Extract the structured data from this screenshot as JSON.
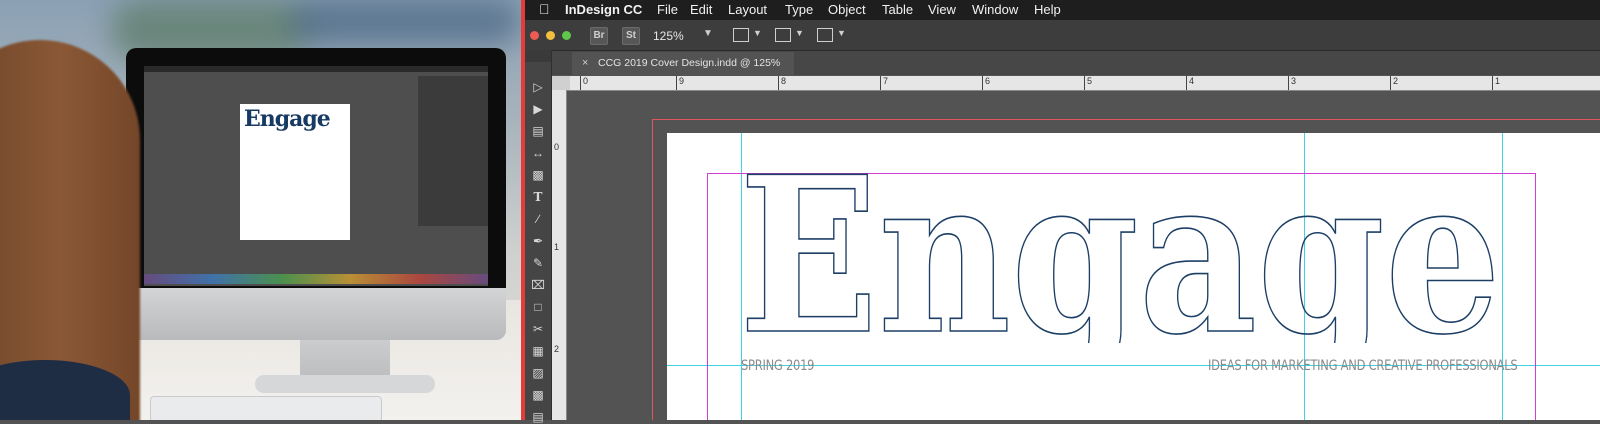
{
  "photo": {
    "mini_title": "Engage"
  },
  "menubar": {
    "app_name": "InDesign CC",
    "items": [
      "File",
      "Edit",
      "Layout",
      "Type",
      "Object",
      "Table",
      "View",
      "Window",
      "Help"
    ]
  },
  "controlbar": {
    "bridge": "Br",
    "stock": "St",
    "zoom": "125%"
  },
  "document": {
    "tab_title": "CCG 2019 Cover Design.indd @ 125%",
    "close_glyph": "×"
  },
  "rulers": {
    "horizontal": [
      "0",
      "9",
      "8",
      "7",
      "6",
      "5",
      "4",
      "3",
      "2",
      "1"
    ],
    "vertical": [
      "0",
      "1",
      "2"
    ]
  },
  "cover": {
    "title": "Engage",
    "issue": "SPRING 2019",
    "tagline": "IDEAS FOR MARKETING AND CREATIVE PROFESSIONALS",
    "title_color": "#1d3f66"
  },
  "colors": {
    "guide": "#3ed3e0",
    "margin": "#d23cd6",
    "bleed": "#e0565c",
    "frame_accent": "#e43b3b"
  }
}
